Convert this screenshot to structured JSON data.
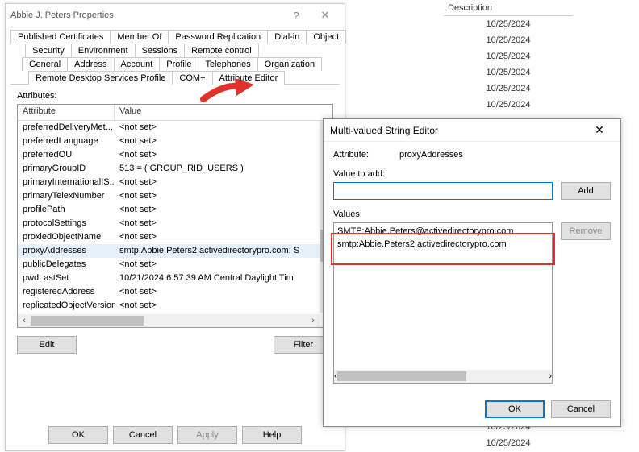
{
  "bg": {
    "header": "Description",
    "dates": [
      "10/25/2024",
      "10/25/2024",
      "10/25/2024",
      "10/25/2024",
      "10/25/2024",
      "10/25/2024",
      "",
      "",
      "",
      "",
      "",
      "",
      "",
      "",
      "",
      "",
      "",
      "",
      "",
      "",
      "",
      "",
      "",
      "",
      "",
      "10/25/2024",
      "10/25/2024"
    ]
  },
  "prop": {
    "title": "Abbie J. Peters Properties",
    "help_glyph": "?",
    "close_glyph": "✕",
    "tabs": {
      "row1": [
        "Published Certificates",
        "Member Of",
        "Password Replication",
        "Dial-in",
        "Object"
      ],
      "row2": [
        "Security",
        "Environment",
        "Sessions",
        "Remote control"
      ],
      "row3": [
        "General",
        "Address",
        "Account",
        "Profile",
        "Telephones",
        "Organization"
      ],
      "row4": [
        "Remote Desktop Services Profile",
        "COM+",
        "Attribute Editor"
      ]
    },
    "active_tab": "Attribute Editor",
    "attributes_label": "Attributes:",
    "columns": {
      "attr": "Attribute",
      "val": "Value"
    },
    "rows": [
      {
        "a": "preferredDeliveryMet...",
        "v": "<not set>"
      },
      {
        "a": "preferredLanguage",
        "v": "<not set>"
      },
      {
        "a": "preferredOU",
        "v": "<not set>"
      },
      {
        "a": "primaryGroupID",
        "v": "513 = ( GROUP_RID_USERS )"
      },
      {
        "a": "primaryInternationalIS...",
        "v": "<not set>"
      },
      {
        "a": "primaryTelexNumber",
        "v": "<not set>"
      },
      {
        "a": "profilePath",
        "v": "<not set>"
      },
      {
        "a": "protocolSettings",
        "v": "<not set>"
      },
      {
        "a": "proxiedObjectName",
        "v": "<not set>"
      },
      {
        "a": "proxyAddresses",
        "v": "smtp:Abbie.Peters2.activedirectorypro.com; S"
      },
      {
        "a": "publicDelegates",
        "v": "<not set>"
      },
      {
        "a": "pwdLastSet",
        "v": "10/21/2024 6:57:39 AM Central Daylight Tim"
      },
      {
        "a": "registeredAddress",
        "v": "<not set>"
      },
      {
        "a": "replicatedObjectVersion",
        "v": "<not set>"
      }
    ],
    "selected_row_index": 9,
    "edit_btn": "Edit",
    "filter_btn": "Filter",
    "ok_btn": "OK",
    "cancel_btn": "Cancel",
    "apply_btn": "Apply",
    "help_btn": "Help"
  },
  "mv": {
    "title": "Multi-valued String Editor",
    "close_glyph": "✕",
    "attr_label": "Attribute:",
    "attr_name": "proxyAddresses",
    "value_to_add_label": "Value to add:",
    "add_btn": "Add",
    "values_label": "Values:",
    "values": [
      "SMTP:Abbie.Peters@activedirectorypro.com",
      "smtp:Abbie.Peters2.activedirectorypro.com"
    ],
    "remove_btn": "Remove",
    "ok_btn": "OK",
    "cancel_btn": "Cancel"
  }
}
